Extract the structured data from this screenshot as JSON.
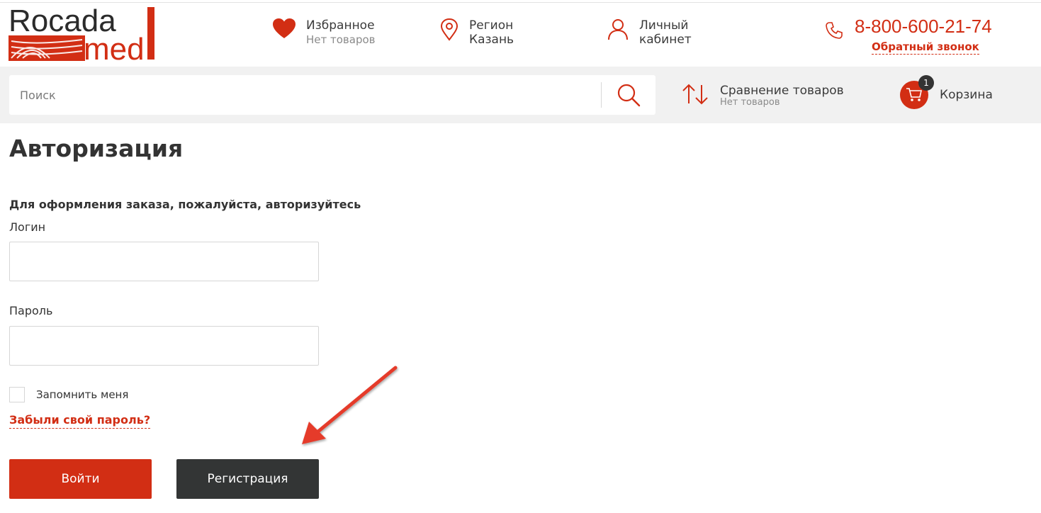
{
  "logo": {
    "line1": "Rocada",
    "line2": "med"
  },
  "header": {
    "favorites": {
      "title": "Избранное",
      "subtitle": "Нет товаров"
    },
    "region": {
      "title": "Регион",
      "subtitle": "Казань"
    },
    "cabinet": {
      "title": "Личный",
      "subtitle": "кабинет"
    },
    "phone": "8-800-600-21-74",
    "callback": "Обратный звонок"
  },
  "search": {
    "placeholder": "Поиск"
  },
  "compare": {
    "title": "Сравнение товаров",
    "subtitle": "Нет товаров"
  },
  "cart": {
    "label": "Корзина",
    "count": "1"
  },
  "page": {
    "title": "Авторизация",
    "notice": "Для оформления заказа, пожалуйста, авторизуйтесь",
    "login_label": "Логин",
    "password_label": "Пароль",
    "remember_label": "Запомнить меня",
    "forgot_link": "Забыли свой пароль?",
    "login_button": "Войти",
    "register_button": "Регистрация"
  },
  "colors": {
    "accent": "#d22e14",
    "dark_button": "#333535",
    "bar": "#f1f1f1"
  },
  "icons": [
    "heart-icon",
    "location-pin-icon",
    "user-icon",
    "phone-icon",
    "search-icon",
    "compare-arrows-icon",
    "cart-icon"
  ]
}
